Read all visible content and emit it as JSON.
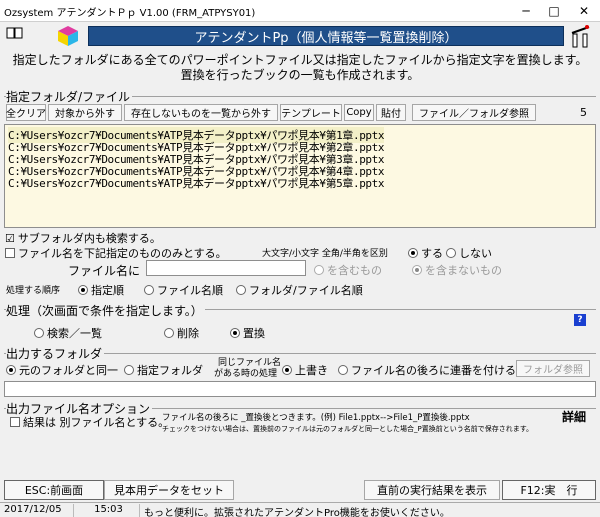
{
  "window": {
    "title": "Ozsystem アテンダントＰｐ V1.00 (FRM_ATPYSY01)",
    "minimize": "─",
    "maximize": "□",
    "close": "✕"
  },
  "header": {
    "title": "アテンダントPp（個人情報等一覧置換削除）",
    "desc1": "指定したフォルダにある全てのパワーポイントファイル又は指定したファイルから指定文字を置換します。",
    "desc2": "置換を行ったブックの一覧も作成されます。"
  },
  "folder_group": {
    "label": "指定フォルダ/ファイル",
    "count": "5",
    "buttons": {
      "clear_all": "全クリア",
      "remove": "対象から外す",
      "remove_missing": "存在しないものを一覧から外す",
      "template": "テンプレート",
      "copy": "Copy",
      "paste": "貼付",
      "browse": "ファイル／フォルダ参照"
    },
    "files": [
      "C:¥Users¥ozcr7¥Documents¥ATP見本データpptx¥パワポ見本¥第1章.pptx",
      "C:¥Users¥ozcr7¥Documents¥ATP見本データpptx¥パワポ見本¥第2章.pptx",
      "C:¥Users¥ozcr7¥Documents¥ATP見本データpptx¥パワポ見本¥第3章.pptx",
      "C:¥Users¥ozcr7¥Documents¥ATP見本データpptx¥パワポ見本¥第4章.pptx",
      "C:¥Users¥ozcr7¥Documents¥ATP見本データpptx¥パワポ見本¥第5章.pptx"
    ]
  },
  "options": {
    "subfolder": "サブフォルダ内も検索する。",
    "filename_filter": "ファイル名を下記指定のもののみとする。",
    "case_label": "大文字/小文字 全角/半角を区別",
    "case_yes": "する",
    "case_no": "しない",
    "filename_in": "ファイル名に",
    "filename_value": "",
    "include": "を含むもの",
    "exclude": "を含まないもの",
    "order_label": "処理する順序",
    "order_specified": "指定順",
    "order_filename": "ファイル名順",
    "order_folder": "フォルダ/ファイル名順"
  },
  "process_group": {
    "label": "処理（次画面で条件を指定します。）",
    "search": "検索／一覧",
    "delete": "削除",
    "replace": "置換",
    "help": "?"
  },
  "output_folder": {
    "label": "出力するフォルダ",
    "same": "元のフォルダと同一",
    "specified": "指定フォルダ",
    "same_name_1": "同じファイル名",
    "same_name_2": "がある時の処理",
    "overwrite": "上書き",
    "serial": "ファイル名の後ろに連番を付ける",
    "browse": "フォルダ参照",
    "path": ""
  },
  "output_name": {
    "label": "出力ファイル名オプション",
    "separate": "結果は 別ファイル名とする。",
    "note1": "ファイル名の後ろに _置換後とつきます。(例) File1.pptx-->File1_P置換後.pptx",
    "note2": "チェックをつけない場合は、置換前のファイルは元のフォルダと同一とした場合_P置換前という名前で保存されます。",
    "detail": "詳細"
  },
  "footer": {
    "back": "ESC:前画面",
    "sample": "見本用データをセット",
    "last_result": "直前の実行結果を表示",
    "run": "F12:実　行"
  },
  "status": {
    "date": "2017/12/05",
    "time": "15:03",
    "message": "もっと便利に。拡張されたアテンダントPro機能をお使いください。"
  },
  "colors": {
    "header_bg": "#1f4f8a",
    "list_bg": "#fdf9e2",
    "help_bg": "#1a3fd0"
  }
}
